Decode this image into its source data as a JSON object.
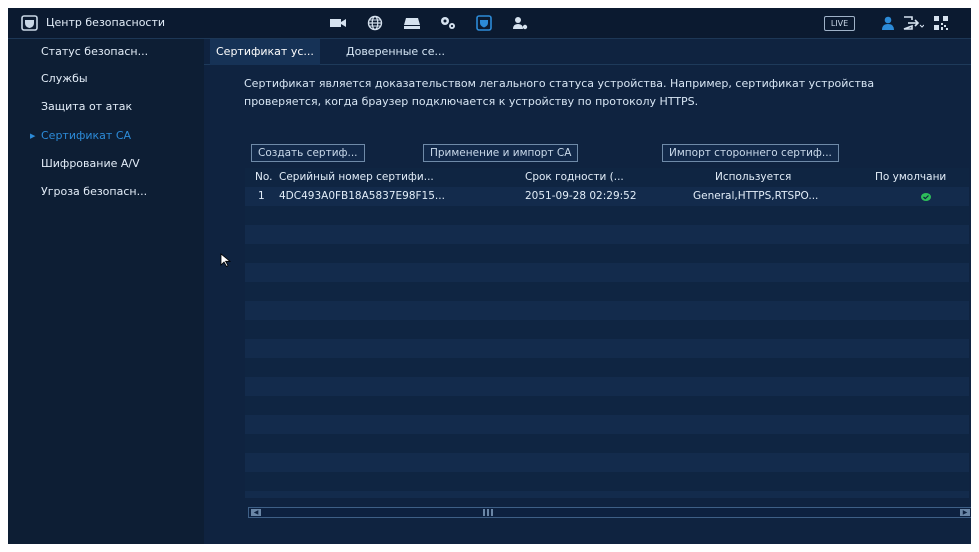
{
  "header": {
    "app_title": "Центр безопасности",
    "live_label": "LIVE",
    "toolbar_icons": [
      "camera-icon",
      "network-globe-icon",
      "storage-icon",
      "settings-icon",
      "security-shield-icon",
      "account-icon"
    ],
    "accent_color": "#2c8bd8"
  },
  "sidebar": {
    "items": [
      {
        "label": "Статус безопасн..."
      },
      {
        "label": "Службы"
      },
      {
        "label": "Защита от атак"
      },
      {
        "label": "Сертификат CA"
      },
      {
        "label": "Шифрование A/V"
      },
      {
        "label": "Угроза безопасн..."
      }
    ],
    "active_index": 3
  },
  "tabs": [
    {
      "label": "Сертификат ус..."
    },
    {
      "label": "Доверенные се..."
    }
  ],
  "description": "Сертификат является доказательством легального статуса устройства. Например, сертификат устройства проверяется, когда браузер подключается к устройству по протоколу HTTPS.",
  "buttons": {
    "create": "Создать сертиф...",
    "apply_import": "Применение и импорт CA",
    "import_third_party": "Импорт стороннего сертиф..."
  },
  "table": {
    "columns": [
      "No.",
      "Серийный номер сертифи...",
      "Срок годности (...",
      "Используется",
      "По умолчани"
    ],
    "rows": [
      {
        "no": "1",
        "serial": "4DC493A0FB18A5837E98F15...",
        "expiry": "2051-09-28 02:29:52",
        "used_by": "General,HTTPS,RTSPO...",
        "default": true
      }
    ]
  }
}
